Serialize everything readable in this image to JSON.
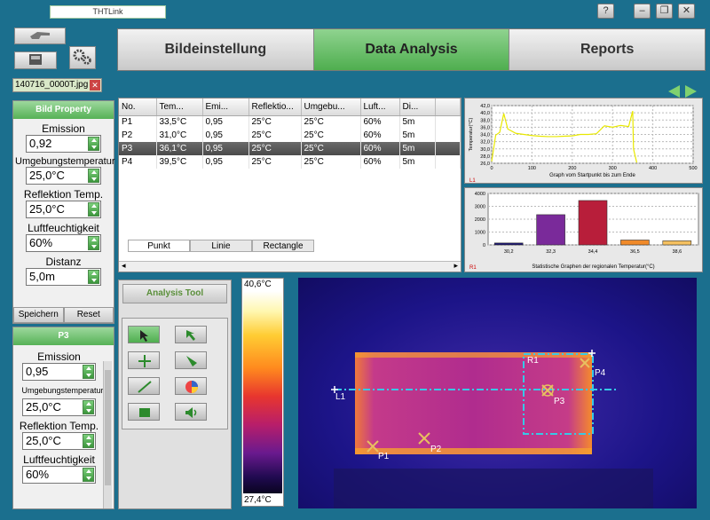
{
  "app": {
    "title": "THTLink"
  },
  "tabs": [
    {
      "label": "Bildeinstellung"
    },
    {
      "label": "Data Analysis"
    },
    {
      "label": "Reports"
    }
  ],
  "file": {
    "name": "140716_0000T.jpg"
  },
  "bild_property": {
    "title": "Bild Property",
    "emission_label": "Emission",
    "emission": "0,92",
    "umgebung_label": "Umgebungstemperatur",
    "umgebung": "25,0°C",
    "reflektion_label": "Reflektion Temp.",
    "reflektion": "25,0°C",
    "luft_label": "Luftfeuchtigkeit",
    "luft": "60%",
    "distanz_label": "Distanz",
    "distanz": "5,0m",
    "save_label": "Speichern",
    "reset_label": "Reset"
  },
  "p3_panel": {
    "title": "P3",
    "emission_label": "Emission",
    "emission": "0,95",
    "umgebung_label": "Umgebungstemperatur",
    "umgebung": "25,0°C",
    "reflektion_label": "Reflektion Temp.",
    "reflektion": "25,0°C",
    "luft_label": "Luftfeuchtigkeit",
    "luft": "60%"
  },
  "table": {
    "headers": [
      "No.",
      "Tem...",
      "Emi...",
      "Reflektio...",
      "Umgebu...",
      "Luft...",
      "Di..."
    ],
    "rows": [
      [
        "P1",
        "33,5°C",
        "0,95",
        "25°C",
        "25°C",
        "60%",
        "5m"
      ],
      [
        "P2",
        "31,0°C",
        "0,95",
        "25°C",
        "25°C",
        "60%",
        "5m"
      ],
      [
        "P3",
        "36,1°C",
        "0,95",
        "25°C",
        "25°C",
        "60%",
        "5m"
      ],
      [
        "P4",
        "39,5°C",
        "0,95",
        "25°C",
        "25°C",
        "60%",
        "5m"
      ]
    ],
    "subtabs": [
      "Punkt",
      "Linie",
      "Rectangle"
    ]
  },
  "line_chart": {
    "ylabel": "Temperatur(°C)",
    "xlabel": "Graph vom Startpunkt bis zum Ende",
    "marker": "L1",
    "yticks": [
      "42,0",
      "40,0",
      "38,0",
      "36,0",
      "34,0",
      "32,0",
      "30,0",
      "28,0",
      "26,0"
    ],
    "xticks": [
      "0",
      "100",
      "200",
      "300",
      "400",
      "500"
    ]
  },
  "bar_chart": {
    "xlabel": "Statistische Graphen der regionalen Temperatur(°C)",
    "marker": "R1",
    "yticks": [
      "4000",
      "3000",
      "2000",
      "1000",
      "0"
    ],
    "categories": [
      "30,2",
      "32,3",
      "34,4",
      "36,5",
      "38,6"
    ]
  },
  "chart_data": [
    {
      "type": "line",
      "xlabel": "Graph vom Startpunkt bis zum Ende",
      "ylabel": "Temperatur(°C)",
      "xlim": [
        0,
        500
      ],
      "ylim": [
        26,
        42
      ],
      "x": [
        0,
        10,
        20,
        30,
        40,
        60,
        80,
        100,
        120,
        140,
        160,
        180,
        200,
        220,
        240,
        260,
        280,
        300,
        320,
        340,
        350,
        352,
        360
      ],
      "y": [
        26.5,
        33.8,
        34.6,
        39.8,
        35.5,
        34.3,
        34.0,
        33.7,
        33.5,
        33.4,
        33.4,
        33.5,
        33.6,
        34.0,
        34.0,
        34.2,
        36.4,
        36.0,
        36.5,
        36.2,
        40.5,
        30.0,
        26.2
      ],
      "grid": true
    },
    {
      "type": "bar",
      "xlabel": "Statistische Graphen der regionalen Temperatur(°C)",
      "categories": [
        "30,2",
        "32,3",
        "34,4",
        "36,5",
        "38,6"
      ],
      "values": [
        150,
        2350,
        3450,
        380,
        320
      ],
      "ylim": [
        0,
        4000
      ],
      "grid": true
    }
  ],
  "analysis_tool": {
    "title": "Analysis Tool"
  },
  "scale": {
    "max": "40,6°C",
    "min": "27,4°C"
  },
  "thermal": {
    "labels": {
      "R1": "R1",
      "P1": "P1",
      "P2": "P2",
      "P3": "P3",
      "P4": "P4",
      "L1": "L1"
    }
  }
}
